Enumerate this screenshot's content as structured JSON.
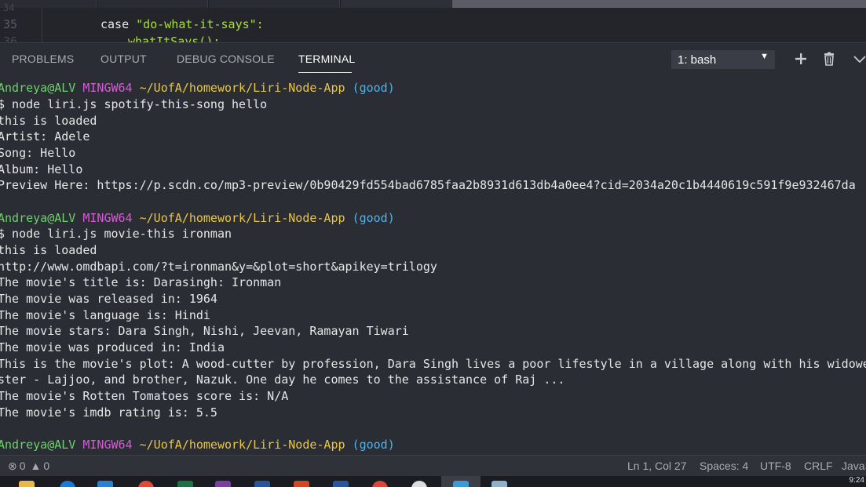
{
  "editor": {
    "line_numbers": [
      "34",
      "35",
      "36"
    ],
    "code_line_keyword": "case ",
    "code_line_string": "\"do-what-it-says\":",
    "code_line_next": "whatItSays();"
  },
  "panel": {
    "tabs": [
      "PROBLEMS",
      "OUTPUT",
      "DEBUG CONSOLE",
      "TERMINAL"
    ],
    "active_tab": "TERMINAL",
    "terminal_select": "1: bash",
    "icons": [
      "plus-icon",
      "trash-icon",
      "chevron-down-icon"
    ]
  },
  "terminal": {
    "prompt": {
      "user": "Andreya@ALV",
      "system": "MINGW64",
      "path": "~/UofA/homework/Liri-Node-App",
      "branch": "(good)"
    },
    "block1": [
      "$ node liri.js spotify-this-song hello",
      "this is loaded",
      "Artist: Adele",
      "Song: Hello",
      "Album: Hello",
      "Preview Here: https://p.scdn.co/mp3-preview/0b90429fd554bad6785faa2b8931d613db4a0ee4?cid=2034a20c1b4440619c591f9e932467da"
    ],
    "block2": [
      "$ node liri.js movie-this ironman",
      "this is loaded",
      "http://www.omdbapi.com/?t=ironman&y=&plot=short&apikey=trilogy",
      "The movie's title is: Darasingh: Ironman",
      "The movie was released in: 1964",
      "The movie's language is: Hindi",
      "The movie stars: Dara Singh, Nishi, Jeevan, Ramayan Tiwari",
      "The movie was produced in: India",
      "This is the movie's plot: A wood-cutter by profession, Dara Singh lives a poor lifestyle in a village along with his widowed mot",
      "ster - Lajjoo, and brother, Nazuk. One day he comes to the assistance of Raj ...",
      "The movie's Rotten Tomatoes score is: N/A",
      "The movie's imdb rating is: 5.5"
    ]
  },
  "statusbar": {
    "errors": "0",
    "warnings": "0",
    "position": "Ln 1, Col 27",
    "spaces": "Spaces: 4",
    "encoding": "UTF-8",
    "eol": "CRLF",
    "language": "JavaS"
  },
  "taskbar": {
    "clock": "9:24"
  }
}
